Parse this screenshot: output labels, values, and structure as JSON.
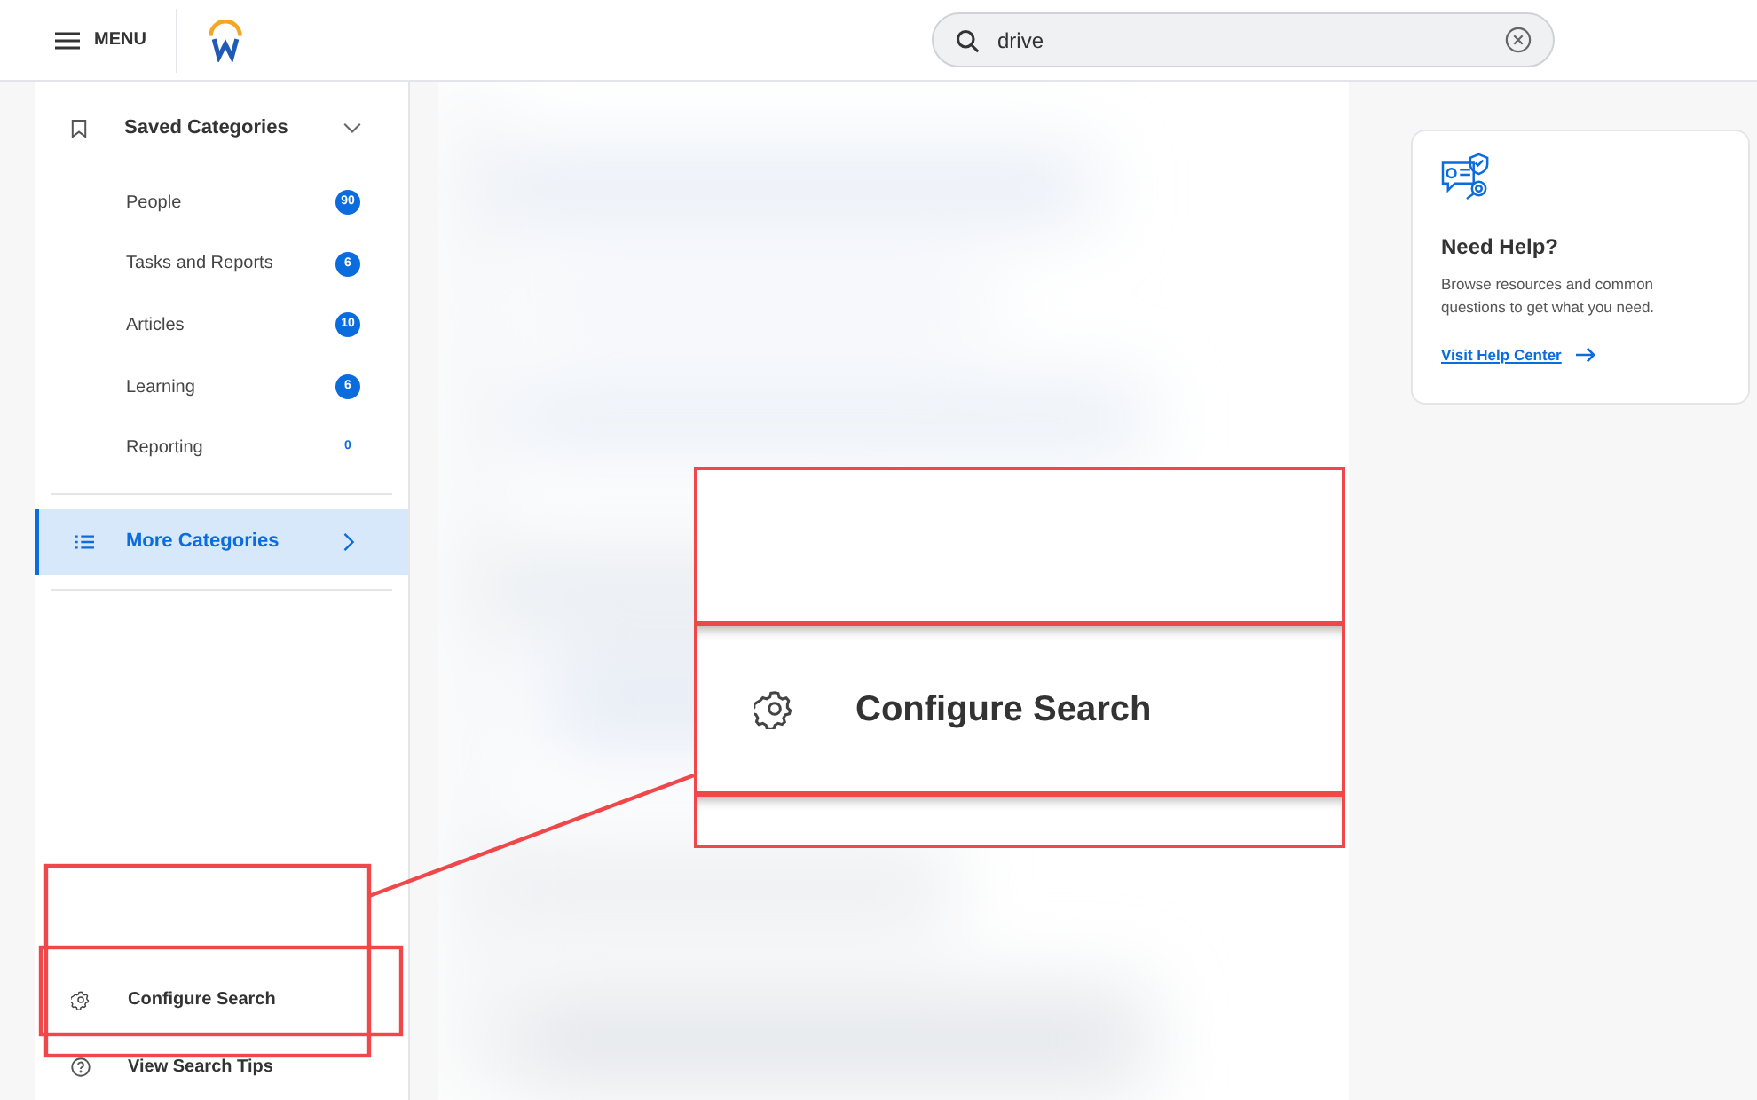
{
  "header": {
    "menu_label": "MENU",
    "search": {
      "value": "drive"
    }
  },
  "sidebar": {
    "section": {
      "title": "Saved Categories",
      "expanded": true
    },
    "items": [
      {
        "label": "People",
        "count": "90",
        "highlighted": true
      },
      {
        "label": "Tasks and Reports",
        "count": "6",
        "highlighted": true
      },
      {
        "label": "Articles",
        "count": "10",
        "highlighted": true
      },
      {
        "label": "Learning",
        "count": "6",
        "highlighted": true
      },
      {
        "label": "Reporting",
        "count": "0",
        "highlighted": false
      }
    ],
    "more": {
      "label": "More Categories",
      "selected": true
    },
    "footer_items": [
      {
        "kind": "settings",
        "label": "Configure Search"
      },
      {
        "kind": "help",
        "label": "View Search Tips"
      }
    ]
  },
  "help_card": {
    "title": "Need Help?",
    "text": "Browse resources and common questions to get what you need.",
    "link": "Visit Help Center"
  },
  "callout": {
    "label": "Configure Search"
  }
}
